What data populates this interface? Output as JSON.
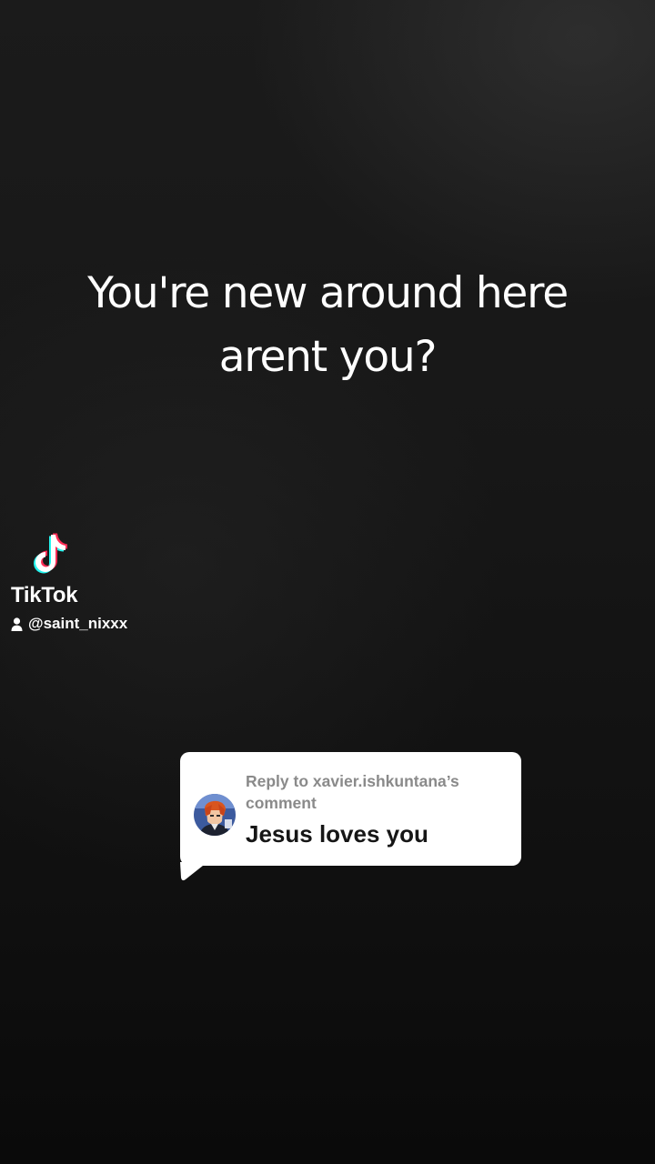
{
  "caption": {
    "line1": "You're new around here",
    "line2": "arent you?"
  },
  "watermark": {
    "logo_icon": "tiktok-note-icon",
    "brand": "TikTok",
    "user_icon": "person-icon",
    "handle": "@saint_nixxx"
  },
  "reply_card": {
    "title": "Reply to xavier.ishkuntana’s comment",
    "text": "Jesus loves you",
    "avatar_icon": "anime-avatar"
  },
  "colors": {
    "background": "#101010",
    "tiktok_cyan": "#25F4EE",
    "tiktok_red": "#FE2C55",
    "reply_title": "#8a8a8a",
    "reply_text": "#161616"
  }
}
